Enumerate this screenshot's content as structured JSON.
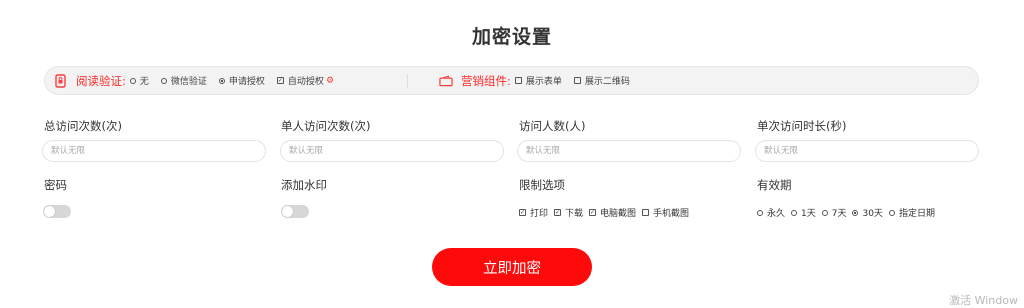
{
  "page": {
    "title": "加密设置"
  },
  "read_verify": {
    "label": "阅读验证:",
    "options": [
      {
        "label": "无",
        "selected": false
      },
      {
        "label": "微信验证",
        "selected": false
      },
      {
        "label": "申请授权",
        "selected": true
      }
    ],
    "auto_auth": {
      "label": "自动授权",
      "checked": true
    }
  },
  "marketing": {
    "label": "营销组件:",
    "options": [
      {
        "label": "展示表单",
        "checked": false
      },
      {
        "label": "展示二维码",
        "checked": false
      }
    ]
  },
  "fields": {
    "total_visits": {
      "label": "总访问次数(次)",
      "placeholder": "默认无限"
    },
    "per_user_visits": {
      "label": "单人访问次数(次)",
      "placeholder": "默认无限"
    },
    "visitor_count": {
      "label": "访问人数(人)",
      "placeholder": "默认无限"
    },
    "visit_duration": {
      "label": "单次访问时长(秒)",
      "placeholder": "默认无限"
    }
  },
  "password": {
    "label": "密码",
    "enabled": false
  },
  "watermark_setting": {
    "label": "添加水印",
    "enabled": false
  },
  "restrictions": {
    "label": "限制选项",
    "options": [
      {
        "label": "打印",
        "checked": true
      },
      {
        "label": "下载",
        "checked": true
      },
      {
        "label": "电脑截图",
        "checked": true
      },
      {
        "label": "手机截图",
        "checked": false
      }
    ]
  },
  "validity": {
    "label": "有效期",
    "options": [
      {
        "label": "永久",
        "selected": false
      },
      {
        "label": "1天",
        "selected": false
      },
      {
        "label": "7天",
        "selected": false
      },
      {
        "label": "30天",
        "selected": true
      },
      {
        "label": "指定日期",
        "selected": false
      }
    ]
  },
  "submit": {
    "label": "立即加密"
  },
  "os_watermark": {
    "text": "激活 Window"
  },
  "colors": {
    "accent": "#ff0a0a",
    "label_red": "#ff2a2a"
  }
}
